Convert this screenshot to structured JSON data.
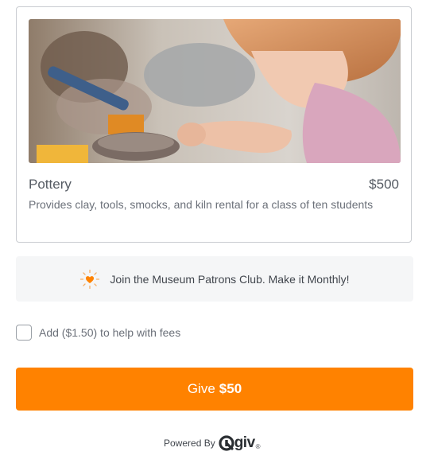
{
  "item": {
    "image_alt": "child working with clay at a pottery table",
    "title": "Pottery",
    "price": "$500",
    "description": "Provides clay, tools, smocks, and kiln rental for a class of ten students"
  },
  "monthly": {
    "icon": "heart-sparkle-icon",
    "text": "Join the Museum Patrons Club. Make it Monthly!"
  },
  "fees": {
    "checked": false,
    "label": "Add ($1.50) to help with fees"
  },
  "give_button": {
    "prefix": "Give",
    "amount": "$50"
  },
  "footer": {
    "powered_by": "Powered By",
    "brand": "giv",
    "registered": "®"
  },
  "colors": {
    "accent": "#ff8200",
    "panel": "#f5f6f7",
    "text": "#555b63"
  }
}
